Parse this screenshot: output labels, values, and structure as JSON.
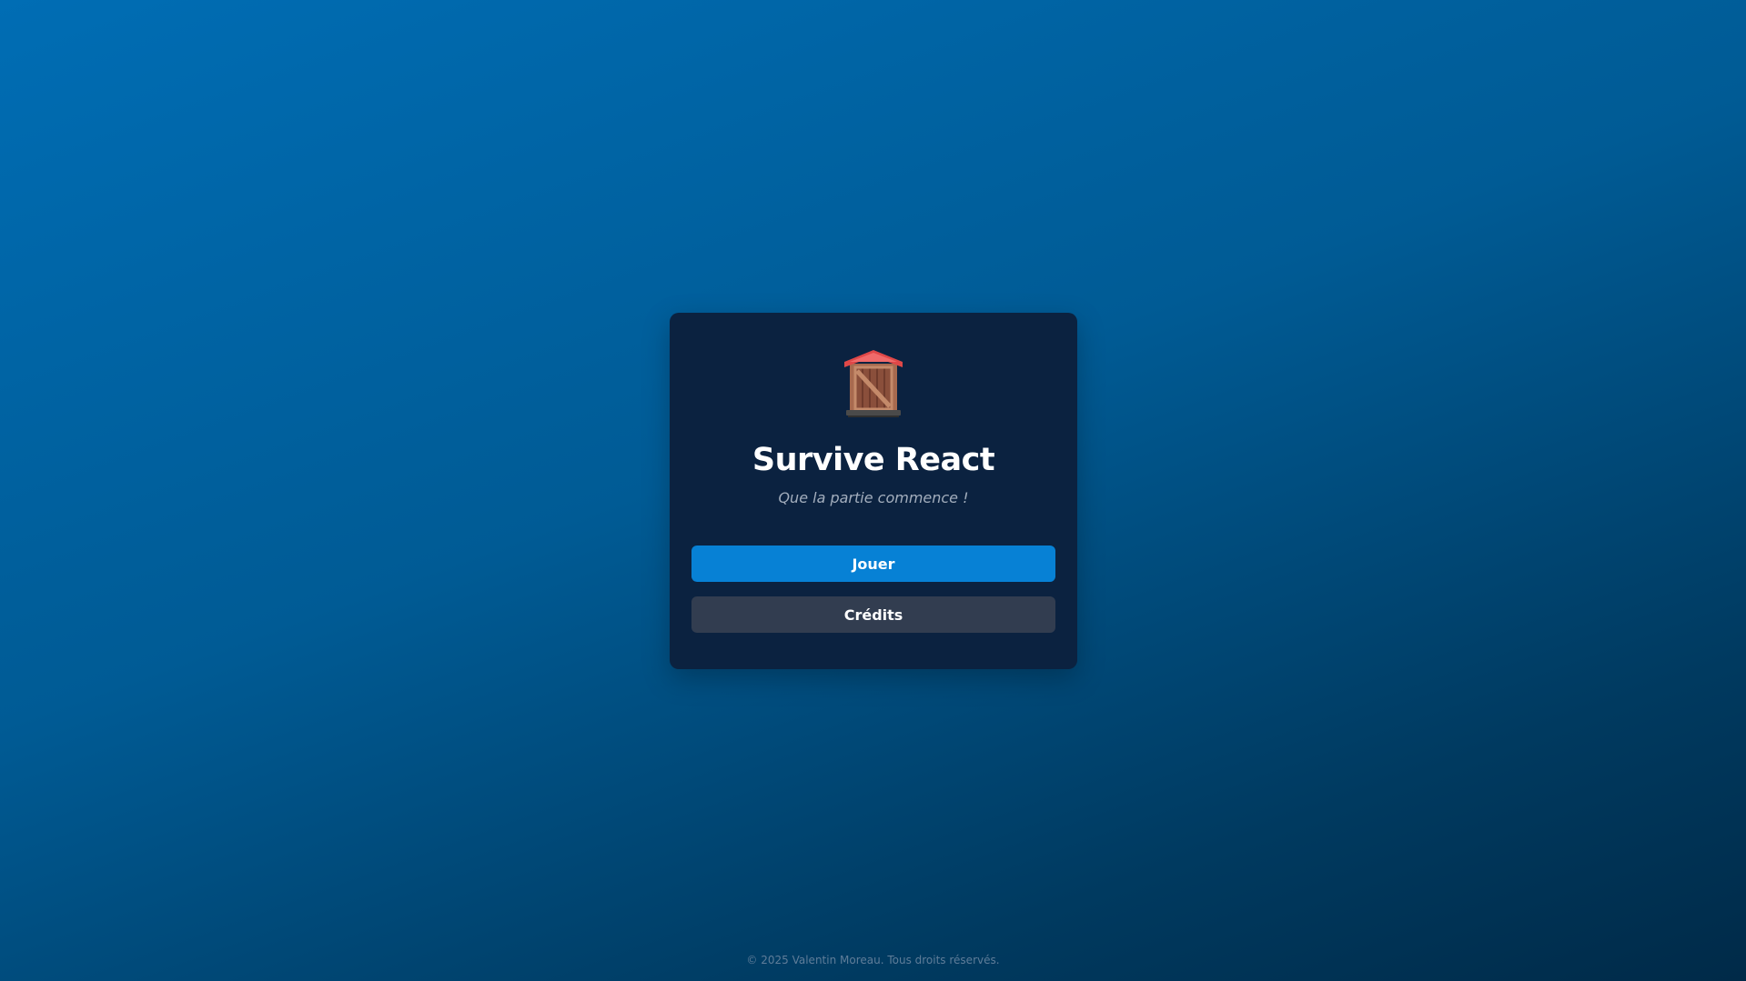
{
  "menu": {
    "logo_icon": "hut-icon",
    "title": "Survive React",
    "subtitle": "Que la partie commence !",
    "play_label": "Jouer",
    "credits_label": "Crédits"
  },
  "footer": {
    "copyright": "© 2025 Valentin Moreau. Tous droits réservés."
  },
  "colors": {
    "background_top": "#006db4",
    "background_bottom": "#002a48",
    "card": "#0b2240",
    "play_button": "#0781d5",
    "credits_button": "#323d50",
    "roof": "#e04848",
    "wood": "#a86a4f"
  }
}
